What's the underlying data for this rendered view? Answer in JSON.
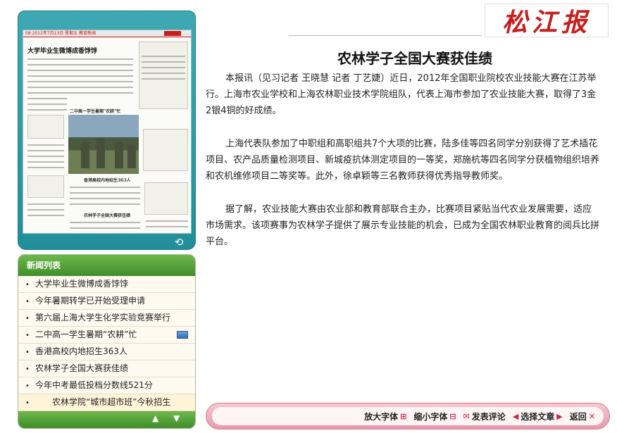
{
  "newspaper_logo": "松江报",
  "thumbnail": {
    "masthead_text": "08 2012年7月13日 星期五 教育新闻",
    "headline": "大学毕业生微博成香饽饽",
    "sub1": "二中高一学生暑期\"农耕\"忙",
    "sub2": "香港高校内地招生363人",
    "sub3": "农林学子全国大赛获佳绩"
  },
  "news_list": {
    "header": "新闻列表",
    "items": [
      {
        "label": "大学毕业生微博成香饽饽",
        "has_image": false,
        "highlight": false
      },
      {
        "label": "今年暑期转学已开始受理申请",
        "has_image": false,
        "highlight": false
      },
      {
        "label": "第六届上海大学生化学实验竞赛举行",
        "has_image": false,
        "highlight": false
      },
      {
        "label": "二中高一学生暑期“农耕”忙",
        "has_image": true,
        "highlight": false
      },
      {
        "label": "香港高校内地招生363人",
        "has_image": false,
        "highlight": false
      },
      {
        "label": "农林学子全国大赛获佳绩",
        "has_image": false,
        "highlight": false
      },
      {
        "label": "今年中考最低投档分数线521分",
        "has_image": false,
        "highlight": false
      },
      {
        "label": "农林学院“城市超市班”今秋招生",
        "has_image": false,
        "highlight": true
      }
    ],
    "bullet": "•",
    "scroll_up_icon": "up-arrow-icon",
    "scroll_down_icon": "down-arrow-icon"
  },
  "article": {
    "title": "农林学子全国大赛获佳绩",
    "paragraphs": [
      "本报讯（见习记者 王晓慧 记者 丁艺婕）近日，2012年全国职业院校农业技能大赛在江苏举行。上海市农业学校和上海农林职业技术学院组队，代表上海市参加了农业技能大赛，取得了3金2银4铜的好成绩。",
      "上海代表队参加了中职组和高职组共7个大项的比赛，陆多佳等四名同学分别获得了艺术插花项目、农产品质量检测项目、新城疫抗体测定项目的一等奖，郑施杭等四名同学分获植物组织培养和农机维修项目二等奖等。此外，徐卓颖等三名教师获得优秀指导教师奖。",
      "据了解，农业技能大赛由农业部和教育部联合主办，比赛项目紧贴当代农业发展需要，适应市场需求。该项赛事为农林学子提供了展示专业技能的机会，已成为全国农林职业教育的阅兵比拼平台。"
    ]
  },
  "toolbar": {
    "enlarge_font": "放大字体",
    "shrink_font": "缩小字体",
    "comment": "发表评论",
    "select_article": "选择文章",
    "back": "返回",
    "enlarge_glyph": "⊞",
    "shrink_glyph": "⊟",
    "comment_glyph": "✉",
    "prev_glyph": "◀",
    "next_glyph": "▶",
    "close_glyph": "✕"
  },
  "colors": {
    "accent_green": "#3f8e2a",
    "accent_teal": "#228e9a",
    "toolbar_pink": "#e798ac",
    "logo_red": "#c81d1d"
  }
}
